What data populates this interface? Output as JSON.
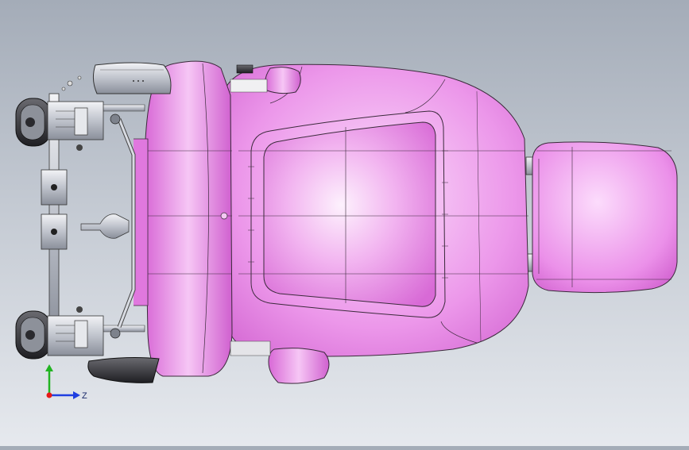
{
  "viewport": {
    "background_top": "#a4acb8",
    "background_bottom": "#e6e9ee"
  },
  "model": {
    "shell_color": "#e57fe3",
    "shell_highlight": "#fbe6fb",
    "edge_color": "#3a2a3a",
    "metal_color": "#c8ccd4",
    "dark_part_color": "#2c2c30"
  },
  "triad": {
    "z_label": "Z",
    "x_color": "#e81818",
    "y_color": "#22b422",
    "z_color": "#1f3fe0"
  }
}
